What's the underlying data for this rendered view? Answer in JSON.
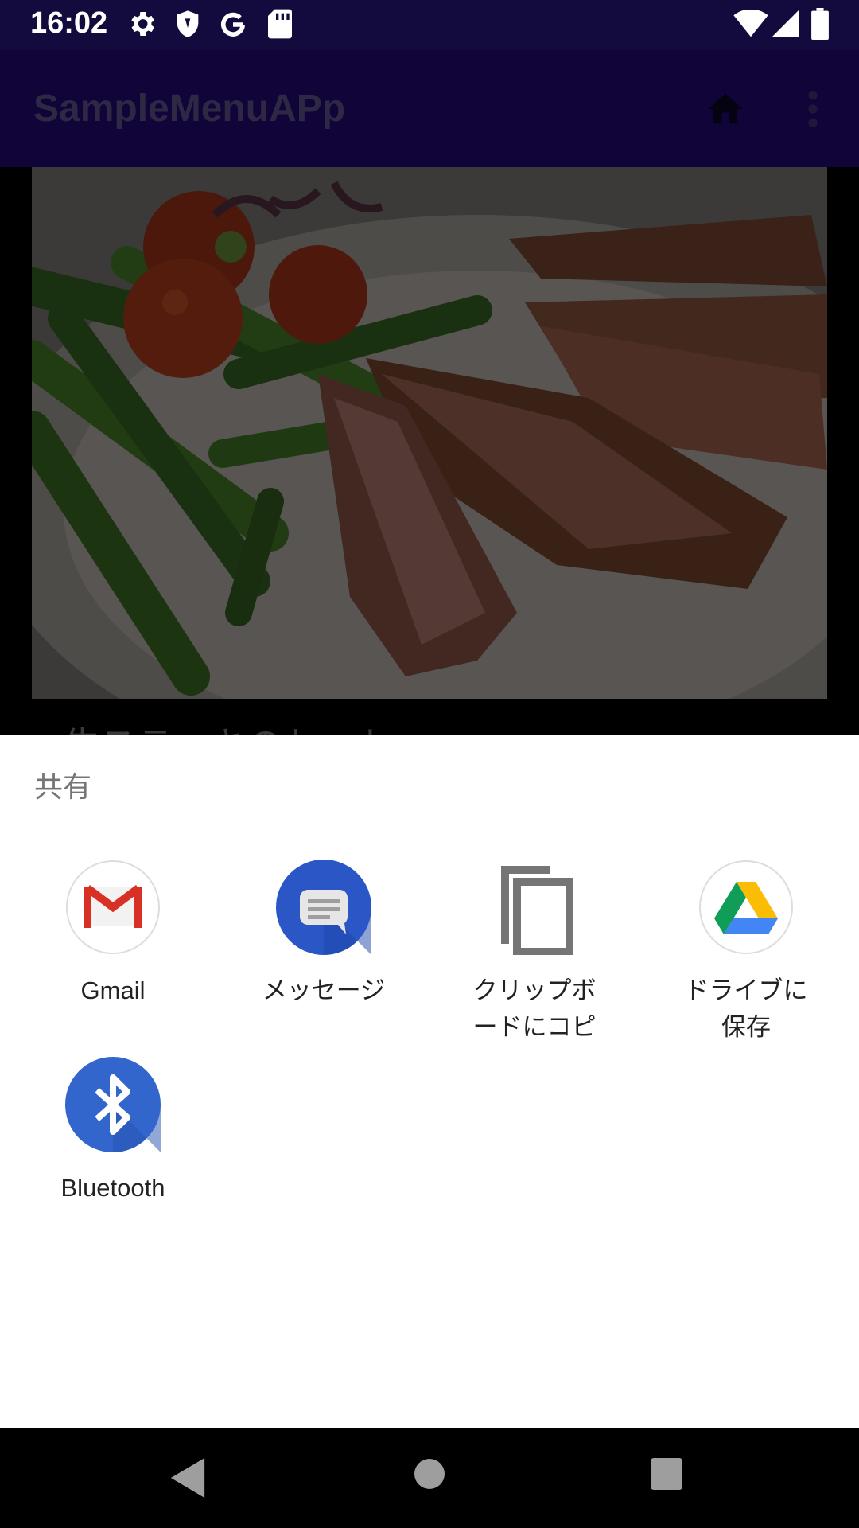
{
  "status_bar": {
    "time": "16:02",
    "left_icons": [
      "gear-icon",
      "shield-icon",
      "google-icon",
      "sd-card-icon"
    ],
    "right_icons": [
      "wifi-icon",
      "signal-icon",
      "battery-icon"
    ]
  },
  "app_bar": {
    "title": "SampleMenuAPp",
    "actions": [
      "home-icon",
      "more-vert-icon"
    ]
  },
  "content": {
    "caption_partial": "牛ステーキのセット"
  },
  "share_sheet": {
    "title": "共有",
    "targets": [
      {
        "label": "Gmail",
        "icon": "gmail-icon"
      },
      {
        "label": "メッセージ",
        "icon": "messages-icon"
      },
      {
        "label": "クリップボ\nードにコピ",
        "icon": "clipboard-copy-icon"
      },
      {
        "label": "ドライブに\n保存",
        "icon": "google-drive-icon"
      },
      {
        "label": "Bluetooth",
        "icon": "bluetooth-icon"
      }
    ]
  },
  "nav_bar": {
    "buttons": [
      "back-icon",
      "home-circle-icon",
      "recents-icon"
    ]
  },
  "colors": {
    "status_bar": "#130a3d",
    "app_bar": "#1f0866",
    "sheet_bg": "#ffffff",
    "scrim": "rgba(0,0,0,0.5)"
  }
}
